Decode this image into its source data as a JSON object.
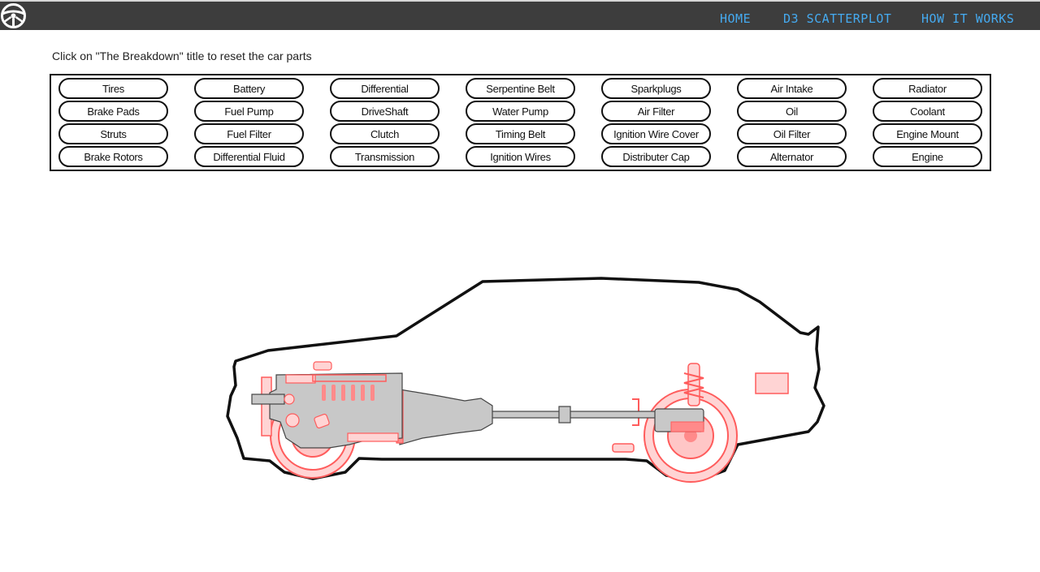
{
  "nav": {
    "logo_icon": "steering-wheel-icon",
    "links": [
      {
        "label": "HOME"
      },
      {
        "label": "D3 SCATTERPLOT"
      },
      {
        "label": "HOW IT WORKS"
      }
    ]
  },
  "instructions": "Click on \"The Breakdown\" title to reset the car parts",
  "parts": {
    "columns": [
      [
        "Tires",
        "Brake Pads",
        "Struts",
        "Brake Rotors"
      ],
      [
        "Battery",
        "Fuel Pump",
        "Fuel Filter",
        "Differential Fluid"
      ],
      [
        "Differential",
        "DriveShaft",
        "Clutch",
        "Transmission"
      ],
      [
        "Serpentine Belt",
        "Water Pump",
        "Timing Belt",
        "Ignition Wires"
      ],
      [
        "Sparkplugs",
        "Air Filter",
        "Ignition Wire Cover",
        "Distributer Cap"
      ],
      [
        "Air Intake",
        "Oil",
        "Oil Filter",
        "Alternator"
      ],
      [
        "Radiator",
        "Coolant",
        "Engine Mount",
        "Engine"
      ]
    ]
  },
  "colors": {
    "navbar": "#3d3d3d",
    "nav_link": "#45aaf0",
    "highlight": "#ff6b6b",
    "component_gray": "#c8c8c8"
  }
}
